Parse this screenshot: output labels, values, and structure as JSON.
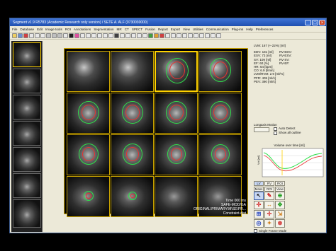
{
  "window": {
    "title": "Segment v1.9 R5783 (Academic Research only version) / SETE A. ALF (0730030000)",
    "controls": [
      "_",
      "□",
      "×"
    ]
  },
  "menu": [
    "File",
    "Database",
    "Edit",
    "Image tools",
    "ROI",
    "Annotations",
    "Segmentation",
    "MR",
    "CT",
    "SPECT",
    "Fusion",
    "Report",
    "Export",
    "View",
    "Utilities",
    "Communication",
    "Plug-ins",
    "Help",
    "Preferences"
  ],
  "overlay_text": [
    "Time 000 ms",
    "SAFE-MOD/GA",
    "ORIGINAL\\PRIMARY\\M\\SE\\PR...",
    "Constraint-dist"
  ],
  "results": {
    "lvm": "LVM: 167 (+-22%) [ml]",
    "edv": "EDV: 181 [ml]",
    "esv": "ESV: 73 [ml]",
    "sv": "SV: 109 [ml]",
    "ef": "EF: 60 [%]",
    "hr": "HR: 64 [bpm]",
    "co": "CO: 6.9 [l/min]",
    "lvm_rvm": "LVM/RVM: 2.9 [ml/%]",
    "pfr": "PFR: 405 [ml/s]",
    "pev": "PEV: 390 [ml/s]",
    "rv_edv": "RV-EDV: ",
    "rv_esv": "RV-ESV: ",
    "rv_sv": "RV-SV: ",
    "rv_ef": "RV-EF: "
  },
  "longaxis": {
    "label": "Longaxis Motion",
    "auto_detect": "Auto Detect",
    "show_all": "Show all outline"
  },
  "volume_chart": {
    "title": "Volume over time [ml]",
    "ylabel": "Vol [ml]"
  },
  "tabs": [
    "LV",
    "RV",
    "ROI",
    "Mass",
    "ROI",
    "View"
  ],
  "single_frame": "Single Frame Mode",
  "tools": [
    "↖",
    "✎",
    "⊕",
    "✣",
    "↔",
    "✥",
    "⊞",
    "✢",
    "⇲",
    "◎",
    "✦",
    "⊗"
  ],
  "colors": {
    "endo": "#e83232",
    "epi": "#2ee04a",
    "highlight": "#ffd200",
    "chart_lv": "#2ee04a",
    "chart_rv": "#e83232"
  }
}
